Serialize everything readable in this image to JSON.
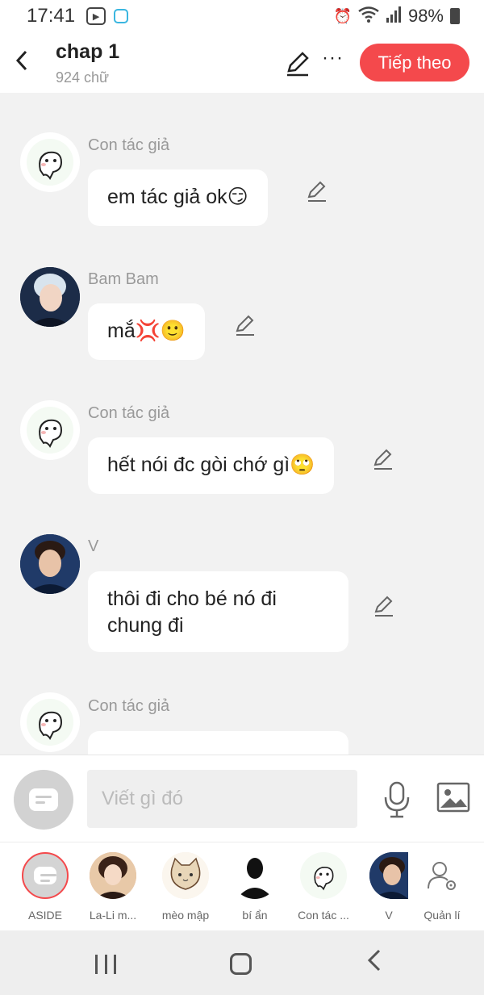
{
  "status_bar": {
    "time": "17:41",
    "battery": "98%"
  },
  "header": {
    "title": "chap 1",
    "word_count": "924 chữ",
    "next_button": "Tiếp theo"
  },
  "messages": [
    {
      "sender": "Con tác giả",
      "text": "em tác giả ok😏",
      "avatar": "ghost-avatar"
    },
    {
      "sender": "Bam Bam",
      "text": "mắ💢🙂",
      "avatar": "photo-avatar"
    },
    {
      "sender": "Con tác giả",
      "text": "hết nói đc gòi chớ gì🙄",
      "avatar": "ghost-avatar"
    },
    {
      "sender": "V",
      "text": "thôi đi cho bé nó đi chung đi",
      "avatar": "photo-avatar"
    },
    {
      "sender": "Con tác giả",
      "text": "",
      "avatar": "ghost-avatar"
    }
  ],
  "input": {
    "placeholder": "Viết gì đó"
  },
  "characters": [
    {
      "name": "ASIDE"
    },
    {
      "name": "La-Li m..."
    },
    {
      "name": "mèo mập"
    },
    {
      "name": "bí ẩn"
    },
    {
      "name": "Con tác ..."
    },
    {
      "name": "V"
    },
    {
      "name": "Quản lí"
    }
  ],
  "colors": {
    "accent": "#f4494c",
    "background": "#f2f2f2"
  }
}
